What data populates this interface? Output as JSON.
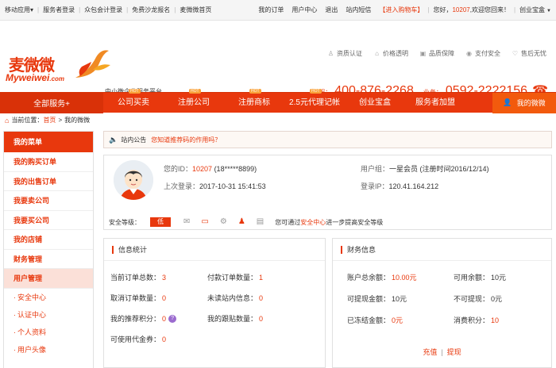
{
  "topbar": {
    "left": [
      "移动应用▾",
      "服务者登录",
      "众包会计登录",
      "免费沙龙报名",
      "麦微微首页"
    ],
    "my_orders": "我的订单",
    "user_center": "用户中心",
    "logout": "退出",
    "messages": "站内短信",
    "cart": "【进入购物车】",
    "hello_prefix": "您好，",
    "user_id": "10207",
    "hello_suffix": ",欢迎您回来！",
    "city": "创业宝盒"
  },
  "logo": {
    "cn": "麦微微",
    "en": "Myweiwei",
    "domain": ".com"
  },
  "slogan": "中小微企业服务平台",
  "assurances": [
    "资质认证",
    "价格透明",
    "品质保障",
    "支付安全",
    "售后无忧"
  ],
  "phones": {
    "label1": "客服：",
    "num1": "400-876-2268",
    "label2": "业务：",
    "num2": "0592-2222156"
  },
  "nav": {
    "all": "全部服务+",
    "items": [
      {
        "label": "公司买卖",
        "hot": "HOT"
      },
      {
        "label": "注册公司",
        "hot": "HOT"
      },
      {
        "label": "注册商标",
        "hot": "HOT"
      },
      {
        "label": "2.5元代理记帐",
        "hot": "HOT"
      },
      {
        "label": "创业宝盒",
        "hot": ""
      },
      {
        "label": "服务者加盟",
        "hot": ""
      }
    ],
    "mine": "我的微微"
  },
  "breadcrumb": {
    "label": "当前位置：",
    "home": "首页",
    "sep": ">",
    "current": "我的微微"
  },
  "sidebar": {
    "header": "我的菜单",
    "items": [
      "我的购买订单",
      "我的出售订单",
      "我要卖公司",
      "我要买公司",
      "我的店铺",
      "财务管理",
      "用户管理"
    ],
    "subitems": [
      "安全中心",
      "认证中心",
      "个人资料",
      "用户头像"
    ]
  },
  "notice": {
    "label": "站内公告",
    "link": "您知道推荐码的作用吗？"
  },
  "user": {
    "id_label": "您的ID：",
    "id_value": "10207",
    "phone": "(18*****8899)",
    "last_login_label": "上次登录：",
    "last_login": "2017-10-31 15:41:53",
    "group_label": "用户组：",
    "group_value": "一星会员 (注册时间2016/12/14)",
    "ip_label": "登录IP：",
    "ip_value": "120.41.164.212",
    "security_label": "安全等级：",
    "security_level": "低",
    "security_tip_pre": "您可通过",
    "security_tip_link": "安全中心",
    "security_tip_post": "进一步提高安全等级"
  },
  "stats": {
    "title": "信息统计",
    "rows": [
      {
        "label": "当前订单总数：",
        "value": "3"
      },
      {
        "label": "付款订单数量：",
        "value": "1"
      },
      {
        "label": "取消订单数量：",
        "value": "0"
      },
      {
        "label": "未读站内信息：",
        "value": "0"
      },
      {
        "label": "我的推荐积分：",
        "value": "0"
      },
      {
        "label": "我的跟贴数量：",
        "value": "0"
      },
      {
        "label": "可使用代金券：",
        "value": "0"
      }
    ]
  },
  "finance": {
    "title": "财务信息",
    "rows": [
      {
        "label": "账户总余额：",
        "value": "10.00元"
      },
      {
        "label": "可用余额：",
        "value": "10元"
      },
      {
        "label": "可提现金额：",
        "value": "10元"
      },
      {
        "label": "不可提现：",
        "value": "0元"
      },
      {
        "label": "已冻结金额：",
        "value": "0元"
      },
      {
        "label": "消费积分：",
        "value": "10"
      }
    ],
    "recharge": "充值",
    "withdraw": "提现"
  }
}
